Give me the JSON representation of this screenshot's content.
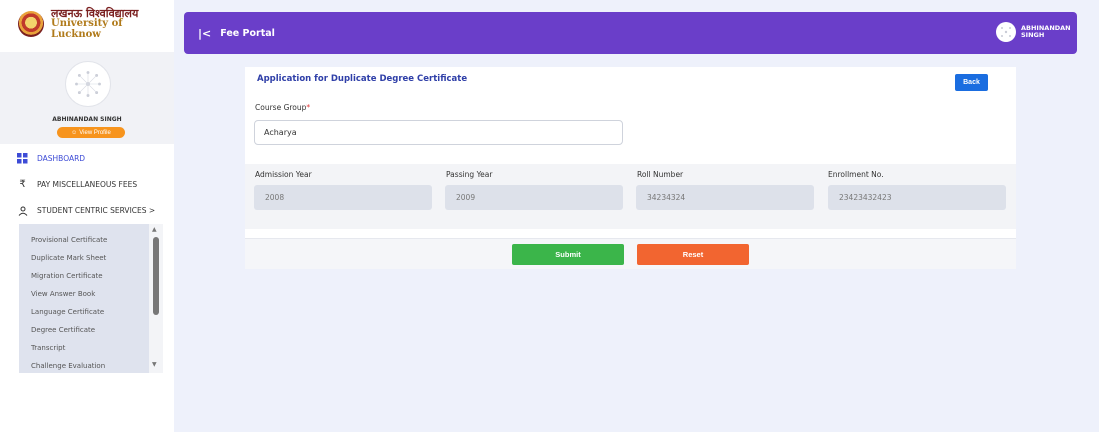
{
  "brand": {
    "hindi_name": "लखनऊ विश्वविद्यालय",
    "english_name": "University of Lucknow"
  },
  "profile": {
    "name": "ABHINANDAN SINGH",
    "view_profile_label": "View Profile"
  },
  "nav": {
    "dashboard": "DASHBOARD",
    "misc_fees": "PAY MISCELLANEOUS FEES",
    "student_services": "STUDENT CENTRIC SERVICES  >"
  },
  "submenu": [
    "Provisional Certificate",
    "Duplicate Mark Sheet",
    "Migration Certificate",
    "View Answer Book",
    "Language Certificate",
    "Degree Certificate",
    "Transcript",
    "Challenge Evaluation"
  ],
  "topbar": {
    "title": "Fee Portal",
    "user_name": "ABHINANDAN SINGH"
  },
  "form": {
    "title": "Application for Duplicate Degree Certificate",
    "back_label": "Back",
    "course_group_label": "Course Group",
    "course_group_required": "*",
    "course_group_value": "Acharya",
    "admission_year_label": "Admission Year",
    "admission_year_value": "2008",
    "passing_year_label": "Passing Year",
    "passing_year_value": "2009",
    "roll_number_label": "Roll Number",
    "roll_number_value": "34234324",
    "enrollment_label": "Enrollment No.",
    "enrollment_value": "23423432423",
    "submit_label": "Submit",
    "reset_label": "Reset"
  },
  "colors": {
    "topbar": "#6a3ec9",
    "submit": "#3bb54a",
    "reset": "#f26530",
    "back": "#1a6de0"
  }
}
